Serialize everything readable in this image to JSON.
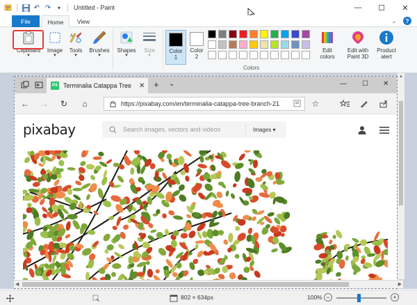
{
  "window": {
    "title": "Untitled - Paint",
    "minimize": "—",
    "maximize": "☐",
    "close": "✕"
  },
  "quick_access": {
    "save": "💾",
    "undo": "↶",
    "redo": "↷",
    "customize": "▾"
  },
  "tabs": {
    "file": "File",
    "home": "Home",
    "view": "View",
    "collapse": "⌄",
    "help": "?"
  },
  "ribbon": {
    "tools": [
      {
        "label": "Clipboard",
        "icon": "clipboard-icon"
      },
      {
        "label": "Image",
        "icon": "image-select-icon"
      },
      {
        "label": "Tools",
        "icon": "tools-icon"
      },
      {
        "label": "Brushes",
        "icon": "brush-icon"
      },
      {
        "label": "Shapes",
        "icon": "shapes-icon"
      },
      {
        "label": "Size",
        "icon": "size-icon"
      }
    ],
    "color1": {
      "label": "Color\n1",
      "color": "#000000"
    },
    "color2": {
      "label": "Color\n2",
      "color": "#ffffff"
    },
    "colors_group_label": "Colors",
    "palette_row1": [
      "#000000",
      "#7f7f7f",
      "#880015",
      "#ed1c24",
      "#ff7f27",
      "#fff200",
      "#22b14c",
      "#00a2e8",
      "#3f48cc",
      "#a349a4"
    ],
    "palette_row2": [
      "#ffffff",
      "#c3c3c3",
      "#b97a57",
      "#ffaec9",
      "#ffc90e",
      "#efe4b0",
      "#b5e61d",
      "#99d9ea",
      "#7092be",
      "#c8bfe7"
    ],
    "edit_colors": "Edit\ncolors",
    "edit_paint3d": "Edit with\nPaint 3D",
    "product_alert": "Product\nalert"
  },
  "browser": {
    "tab_title": "Terminalia Catappa Tree",
    "tab_close": "✕",
    "new_tab": "+",
    "tab_list": "⌄",
    "favicon": "PX",
    "back": "←",
    "forward": "→",
    "refresh": "↻",
    "home": "⌂",
    "url": "https://pixabay.com/en/terminalia-catappa-tree-branch-21",
    "favorite": "☆",
    "win_min": "—",
    "win_max": "☐",
    "win_close": "✕"
  },
  "page": {
    "logo": "pixabay",
    "search_placeholder": "Search images, vectors and videos",
    "search_type": "Images ▾"
  },
  "status": {
    "dimensions": "802 × 634px",
    "zoom": "100%",
    "zoom_level": 0.45,
    "minus": "−",
    "plus": "+"
  }
}
